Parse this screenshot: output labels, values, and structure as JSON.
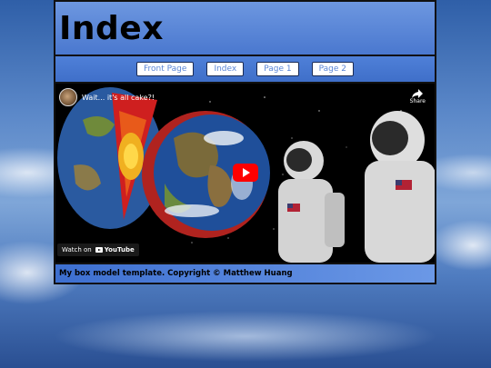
{
  "header": {
    "title": "Index"
  },
  "nav": {
    "items": [
      {
        "label": "Front Page"
      },
      {
        "label": "Index"
      },
      {
        "label": "Page 1"
      },
      {
        "label": "Page 2"
      }
    ]
  },
  "video": {
    "title": "Wait... it's all cake?!",
    "share_label": "Share",
    "watch_on_label": "Watch on",
    "platform_label": "YouTube"
  },
  "footer": {
    "text": "My box model template. Copyright © Matthew Huang"
  },
  "colors": {
    "accent": "#5b86d6",
    "play_button": "#ff0000"
  }
}
